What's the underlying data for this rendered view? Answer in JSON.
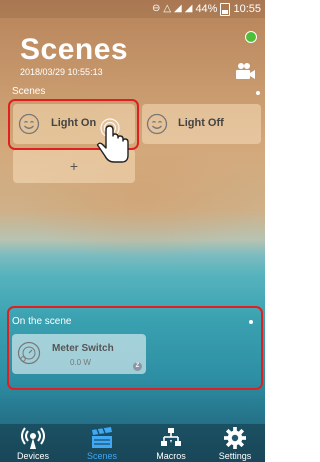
{
  "status_bar": {
    "battery": "44%",
    "time": "10:55"
  },
  "header": {
    "title": "Scenes",
    "datetime": "2018/03/29 10:55:13"
  },
  "scenes_section": {
    "label": "Scenes",
    "items": [
      {
        "label": "Light On",
        "icon": "smile-face-icon"
      },
      {
        "label": "Light Off",
        "icon": "smile-face-icon"
      }
    ],
    "add_label": "+"
  },
  "on_scene_section": {
    "label": "On the scene",
    "device": {
      "name": "Meter Switch",
      "value": "0.0 W",
      "badge": "Z"
    }
  },
  "tabs": [
    {
      "label": "Devices",
      "icon": "devices-icon"
    },
    {
      "label": "Scenes",
      "icon": "scenes-icon",
      "active": true
    },
    {
      "label": "Macros",
      "icon": "macros-icon"
    },
    {
      "label": "Settings",
      "icon": "gear-icon"
    }
  ],
  "colors": {
    "active_tab": "#3fa9f5",
    "highlight": "#e02020",
    "status_dot": "#4fbf3a"
  }
}
